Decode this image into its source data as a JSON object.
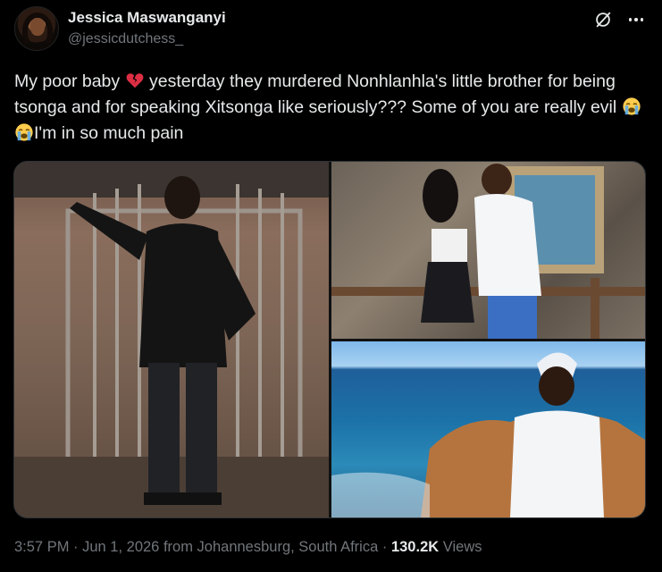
{
  "author": {
    "display_name": "Jessica Maswanganyi",
    "handle": "@jessicdutchess_"
  },
  "tweet": {
    "text_part1": "My poor baby ",
    "emoji1": "broken-heart-emoji",
    "text_part2": " yesterday they murdered Nonhlanhla's little brother for being tsonga and for speaking Xitsonga like seriously??? Some of you are really evil ",
    "emoji2": "loudly-crying-face-emoji",
    "text_part3": "I'm in so much pain"
  },
  "media": {
    "photos": [
      {
        "name": "photo-young-man-at-gate"
      },
      {
        "name": "photo-couple-at-viewpoint"
      },
      {
        "name": "photo-young-man-by-ocean"
      }
    ]
  },
  "footer": {
    "time": "3:57 PM",
    "date": "Jun 1, 2026",
    "location": "from Johannesburg, South Africa",
    "views_count": "130.2K",
    "views_label": "Views"
  },
  "icons": {
    "grok": "grok-icon",
    "more": "more-icon"
  },
  "colors": {
    "background": "#000000",
    "text_primary": "#e7e9ea",
    "text_secondary": "#71767b"
  }
}
